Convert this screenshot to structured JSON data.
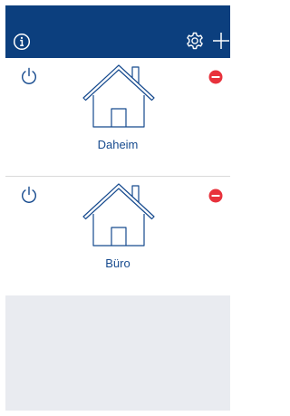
{
  "navbar": {
    "background": "#0c3f7e",
    "icons": {
      "info": "info-circle-icon",
      "settings": "gear-icon",
      "add": "plus-icon"
    }
  },
  "locations": [
    {
      "name": "Daheim",
      "icon": "house-icon"
    },
    {
      "name": "Büro",
      "icon": "house-icon"
    }
  ],
  "colors": {
    "accent": "#164a8e",
    "remove": "#e8323c",
    "empty_area": "#e9ebf0"
  }
}
